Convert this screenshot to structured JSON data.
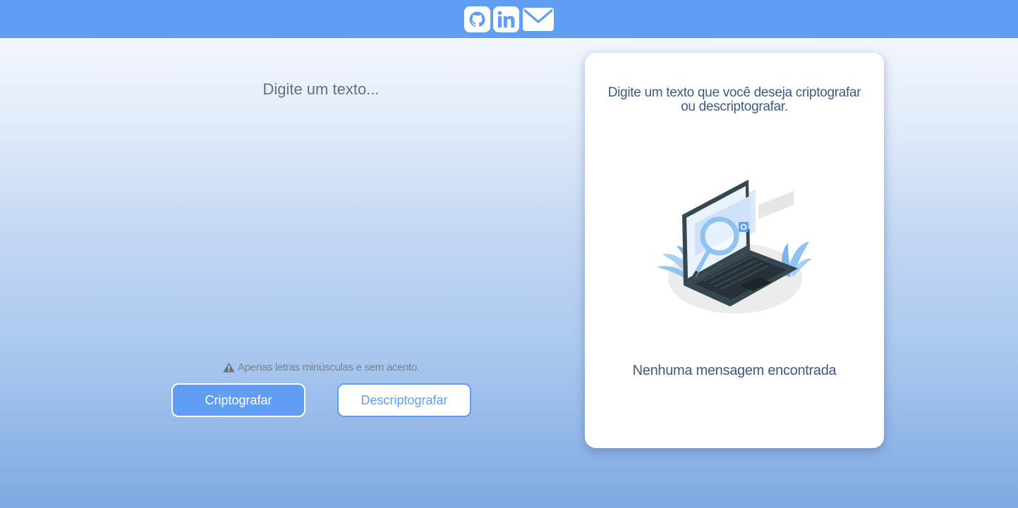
{
  "header": {
    "links": [
      {
        "icon": "github-icon"
      },
      {
        "icon": "linkedin-icon"
      },
      {
        "icon": "mail-icon"
      }
    ],
    "background_color": "#5f9ef2"
  },
  "input": {
    "placeholder": "Digite um texto...",
    "value": ""
  },
  "warning": {
    "icon": "warning-icon",
    "text": "Apenas letras minúsculas e sem acento."
  },
  "buttons": {
    "encrypt_label": "Criptografar",
    "decrypt_label": "Descriptografar"
  },
  "output_card": {
    "title": "Digite um texto que você deseja criptografar ou descriptografar.",
    "illustration": "laptop-search-illustration",
    "empty_message": "Nenhuma mensagem encontrada"
  },
  "colors": {
    "accent": "#5f9ef2",
    "card_text": "#3b5a86"
  }
}
